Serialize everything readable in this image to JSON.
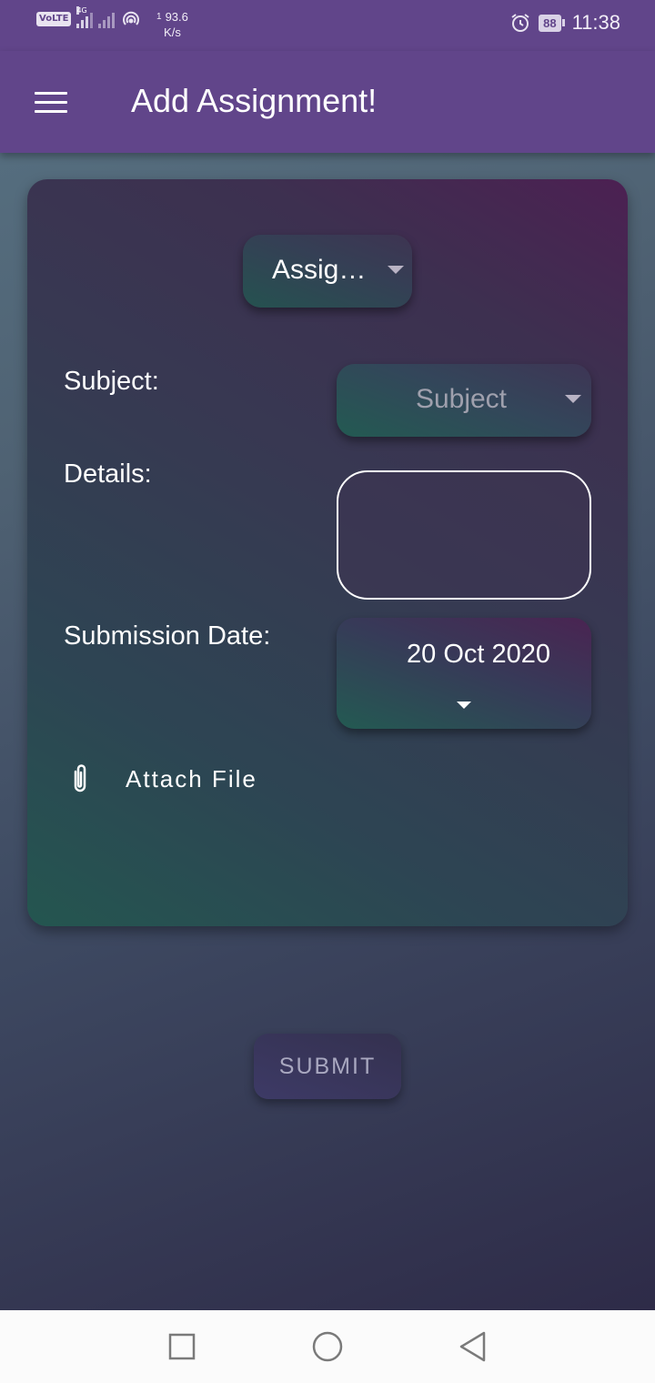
{
  "status_bar": {
    "network": "VoLTE",
    "network_type": "4G",
    "data_speed_value": "93.6",
    "data_speed_unit": "K/s",
    "data_speed_sup": "1",
    "battery_level": "88",
    "time": "11:38",
    "icons": [
      "volte-icon",
      "signal-icon",
      "no-signal-icon",
      "hotspot-icon",
      "alarm-icon",
      "battery-icon"
    ]
  },
  "app_bar": {
    "title": "Add Assignment!",
    "menu_icon": "hamburger-menu-icon"
  },
  "form": {
    "type_selected": "Assig…",
    "subject_label": "Subject:",
    "subject_placeholder": "Subject",
    "details_label": "Details:",
    "details_value": "",
    "date_label": "Submission Date:",
    "date_value": "20 Oct 2020",
    "attach_label": "Attach File",
    "attach_icon": "paperclip-icon"
  },
  "submit_label": "SUBMIT",
  "nav_bar": {
    "buttons": [
      "recent-apps-icon",
      "home-icon",
      "back-icon"
    ]
  },
  "colors": {
    "app_bar": "#61458a",
    "nav_bar": "#fbfbfb",
    "text_primary": "#ffffff",
    "placeholder": "#9fa0ad",
    "submit_text": "#a9a8c0"
  }
}
